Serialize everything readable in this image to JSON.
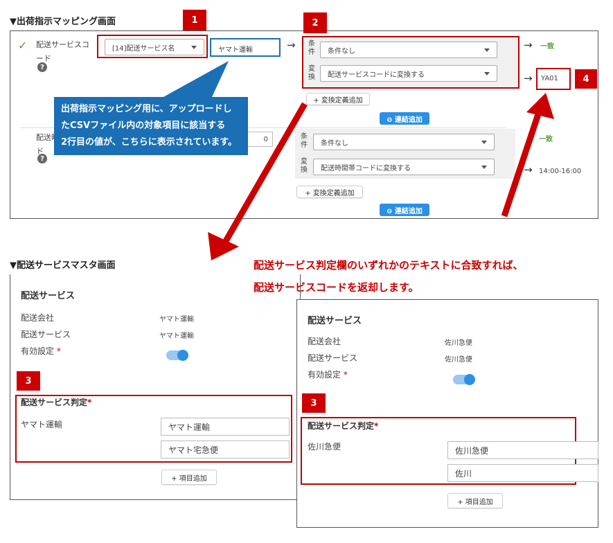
{
  "mapping": {
    "title": "▼出荷指示マッピング画面",
    "row1": {
      "check": "✓",
      "label_line1": "配送サービスコ",
      "label_line2": "ード",
      "help": "?",
      "source_select": "[14]配送サービス名",
      "source_value": "ヤマト運輸",
      "arrow": "→",
      "cond_label_1": "条",
      "cond_label_2": "件",
      "cond_select": "条件なし",
      "conv_label_1": "変",
      "conv_label_2": "換",
      "conv_select": "配送サービスコードに変換する",
      "result_status": "一致",
      "result_value": "YA01",
      "add_conv_button": "+ 変換定義追加",
      "add_link_button": "⊖ 連結追加"
    },
    "row2": {
      "label_line1": "配送時",
      "label_line2": "ド",
      "help": "?",
      "source_partial": "0",
      "cond_label_1": "条",
      "cond_label_2": "件",
      "cond_select": "条件なし",
      "conv_label_1": "変",
      "conv_label_2": "換",
      "conv_select": "配送時間帯コードに変換する",
      "result_status": "一致",
      "result_value": "14:00-16:00",
      "add_conv_button": "+ 変換定義追加",
      "add_link_button": "⊖ 連結追加"
    }
  },
  "badges": {
    "b1": "1",
    "b2": "2",
    "b3a": "3",
    "b3b": "3",
    "b4": "4"
  },
  "callout": {
    "line1": "出荷指示マッピング用に、アップロードし",
    "line2": "たCSVファイル内の対象項目に該当する",
    "line3": "2行目の値が、こちらに表示されています。"
  },
  "master": {
    "title": "▼配送サービスマスタ画面",
    "note_line1": "配送サービス判定欄のいずれかのテキストに合致すれば、",
    "note_line2": "配送サービスコードを返却します。",
    "left": {
      "heading": "配送サービス",
      "company_label": "配送会社",
      "company_value": "ヤマト運輸",
      "service_label": "配送サービス",
      "service_value": "ヤマト運輸",
      "enabled_label": "有効設定",
      "judge_label": "配送サービス判定",
      "judge_name": "ヤマト運輸",
      "inputs": [
        "ヤマト運輸",
        "ヤマト宅急便"
      ],
      "add_button": "+ 項目追加"
    },
    "right": {
      "heading": "配送サービス",
      "company_label": "配送会社",
      "company_value": "佐川急便",
      "service_label": "配送サービス",
      "service_value": "佐川急便",
      "enabled_label": "有効設定",
      "judge_label": "配送サービス判定",
      "judge_name": "佐川急便",
      "inputs": [
        "佐川急便",
        "佐川"
      ],
      "add_button": "+ 項目追加"
    },
    "required_mark": "*"
  },
  "colors": {
    "accent_red": "#c00000",
    "callout_blue": "#1a6fb5",
    "button_blue": "#2b8fe5",
    "match_green": "#5a9e3a"
  }
}
